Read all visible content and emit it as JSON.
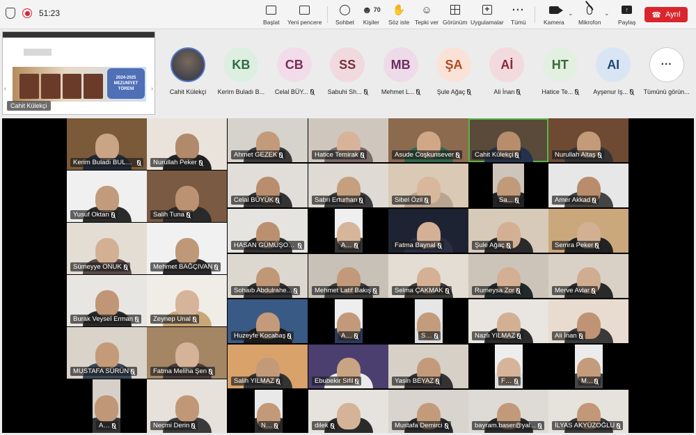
{
  "toolbar": {
    "timer": "51:23",
    "participant_count": "70",
    "buttons": {
      "start": "Başlat",
      "new_window": "Yeni pencere",
      "chat": "Sohbet",
      "people": "Kişiler",
      "raise_hand": "Söz iste",
      "react": "Tepki ver",
      "view": "Görünüm",
      "apps": "Uygulamalar",
      "more": "Tümü",
      "camera": "Kamera",
      "mic": "Mikrofon",
      "share": "Paylaş"
    },
    "leave_label": "Ayrıl",
    "leave_color": "#d9262d"
  },
  "share_thumb": {
    "presenter": "Cahit Külekçi",
    "banner_text_1": "2024-2025",
    "banner_text_2": "MEZUNİYET",
    "banner_text_3": "TÖRENİ"
  },
  "strip": {
    "items": [
      {
        "initials": "",
        "name": "Cahit Külekçi",
        "bg": "",
        "fg": "",
        "photo": true,
        "muted": false
      },
      {
        "initials": "KB",
        "name": "Kerim Buladı B...",
        "bg": "#dcefe1",
        "fg": "#2f6b45",
        "photo": false,
        "muted": false
      },
      {
        "initials": "CB",
        "name": "Celal BÜY...",
        "bg": "#f3dcea",
        "fg": "#7a2d5a",
        "photo": false,
        "muted": true
      },
      {
        "initials": "SS",
        "name": "Sabuhi Sh...",
        "bg": "#f1dadf",
        "fg": "#74303f",
        "photo": false,
        "muted": true
      },
      {
        "initials": "MB",
        "name": "Mehmet L...",
        "bg": "#eedbe9",
        "fg": "#6e2c60",
        "photo": false,
        "muted": true
      },
      {
        "initials": "ŞA",
        "name": "Şule Ağaç",
        "bg": "#fbe2d6",
        "fg": "#b24a1e",
        "photo": false,
        "muted": true
      },
      {
        "initials": "Aİ",
        "name": "Ali İnan",
        "bg": "#f3dade",
        "fg": "#8c2a3a",
        "photo": false,
        "muted": true
      },
      {
        "initials": "HT",
        "name": "Hatice Te...",
        "bg": "#e2efe1",
        "fg": "#3a6a3a",
        "photo": false,
        "muted": true
      },
      {
        "initials": "AI",
        "name": "Ayşenur Iş...",
        "bg": "#d9e5f4",
        "fg": "#24467a",
        "photo": false,
        "muted": true
      },
      {
        "initials": "···",
        "name": "Tümünü görün...",
        "bg": "#ffffff",
        "fg": "#333333",
        "photo": false,
        "muted": false
      }
    ]
  },
  "gallery": {
    "tiles": [
      {
        "name": "Kerim Buladı BULADI",
        "bg": "#7b5a3a",
        "skin": "#c9a585",
        "shirt": "#1f2a3a"
      },
      {
        "name": "Nurullah Peker",
        "bg": "#e9e3dc",
        "skin": "#b08a6a",
        "shirt": "#222"
      },
      {
        "name": "Ahmet GEZEK",
        "bg": "#d6d2cc",
        "skin": "#c39a7a",
        "shirt": "#3a3a3a"
      },
      {
        "name": "Hatice Temirak",
        "bg": "#cfc7bd",
        "skin": "#d7b39a",
        "shirt": "#7a6a6a"
      },
      {
        "name": "Asude Coşkunsever",
        "bg": "#8c6a4e",
        "skin": "#d0a887",
        "shirt": "#2f6a4a"
      },
      {
        "name": "Cahit Külekçi",
        "bg": "#5a4a3a",
        "skin": "#b88d6c",
        "shirt": "#24314d"
      },
      {
        "name": "Nurullah Altaş",
        "bg": "#6e4a33",
        "skin": "#c49b78",
        "shirt": "#333"
      },
      {
        "name": "Yusuf Oktan",
        "bg": "#f0f0f0",
        "skin": "#c29b7c",
        "shirt": "#2b2b2b"
      },
      {
        "name": "Salih Tuna",
        "bg": "#7a5a42",
        "skin": "#bb9272",
        "shirt": "#2a2a2a"
      },
      {
        "name": "Celal BÜYÜK",
        "bg": "#e1ddd8",
        "skin": "#b88e6e",
        "shirt": "#333"
      },
      {
        "name": "Sabri Erturhan",
        "bg": "#dfdad4",
        "skin": "#c4a07f",
        "shirt": "#3a3a3a"
      },
      {
        "name": "Sibel Özil",
        "bg": "#d9c9b5",
        "skin": "#d8b79c",
        "shirt": "#b9a58f"
      },
      {
        "name": "Sa...",
        "bg": "#cdc5bb",
        "skin": "#c19a7a",
        "shirt": "#222"
      },
      {
        "name": "Amer Akkad",
        "bg": "#e7e7e7",
        "skin": "#b98d6b",
        "shirt": "#444"
      },
      {
        "name": "Sümeyye ONUK",
        "bg": "#e3ddd4",
        "skin": "#d3b093",
        "shirt": "#5a4a4a"
      },
      {
        "name": "Mehmet BAĞÇIVAN",
        "bg": "#f1f1f1",
        "skin": "#bf9878",
        "shirt": "#2a2a2a"
      },
      {
        "name": "HASAN GÜMÜŞOĞLU",
        "bg": "#e6e4e0",
        "skin": "#bb9070",
        "shirt": "#333"
      },
      {
        "name": "Ay...",
        "bg": "#efefef",
        "skin": "#d6b59a",
        "shirt": "#333"
      },
      {
        "name": "Fatma Baynal",
        "bg": "#1e2333",
        "skin": "#d4b196",
        "shirt": "#2d2d44"
      },
      {
        "name": "Şule Ağaç",
        "bg": "#d7cab9",
        "skin": "#d3b094",
        "shirt": "#2a2a2a"
      },
      {
        "name": "Semra Peker",
        "bg": "#cba77c",
        "skin": "#d3b094",
        "shirt": "#222"
      },
      {
        "name": "Burak Veysel Erman",
        "bg": "#e8e6e3",
        "skin": "#c09676",
        "shirt": "#2a2a2a"
      },
      {
        "name": "Zeynep Unal",
        "bg": "#f0ece6",
        "skin": "#d6b499",
        "shirt": "#c9a777"
      },
      {
        "name": "Sohaıb Abdulrahe...",
        "bg": "#ddd8cf",
        "skin": "#c09777",
        "shirt": "#333"
      },
      {
        "name": "Mehmet Latif Bakış",
        "bg": "#c7c1b7",
        "skin": "#c29a79",
        "shirt": "#3c3c3c"
      },
      {
        "name": "Selma ÇAKMAK",
        "bg": "#e4ddd3",
        "skin": "#d4b195",
        "shirt": "#3e3a36"
      },
      {
        "name": "Rumeysa Zor",
        "bg": "#cdc4b9",
        "skin": "#d3af93",
        "shirt": "#1f2a2a"
      },
      {
        "name": "Merve Avlar",
        "bg": "#d9d1c6",
        "skin": "#d0ad91",
        "shirt": "#2a2a2a"
      },
      {
        "name": "MUSTAFA SÜRÜN",
        "bg": "#d9d3ca",
        "skin": "#c49a78",
        "shirt": "#3a4a5a"
      },
      {
        "name": "Fatma Meliha Şen",
        "bg": "#a48664",
        "skin": "#d5b398",
        "shirt": "#4a3a3a"
      },
      {
        "name": "Huzeyfe Kocabaş",
        "bg": "#3a5a86",
        "skin": "#c39b7a",
        "shirt": "#1a1a1a"
      },
      {
        "name": "Al...",
        "bg": "#eeeeee",
        "skin": "#c29a7a",
        "shirt": "#2a3a5a"
      },
      {
        "name": "Sa...",
        "bg": "#e6e6e6",
        "skin": "#c39c7c",
        "shirt": "#ddd"
      },
      {
        "name": "Nazlı YILMAZ",
        "bg": "#e9e6e1",
        "skin": "#d3b094",
        "shirt": "#2a2a2a"
      },
      {
        "name": "Ali İnan",
        "bg": "#e8dcd0",
        "skin": "#bf9373",
        "shirt": "#3a3a3a"
      },
      {
        "name": "Salih YILMAZ",
        "bg": "#d9a26a",
        "skin": "#c29a79",
        "shirt": "#333"
      },
      {
        "name": "Ebubekir Sifil",
        "bg": "#4a3f6e",
        "skin": "#c9a483",
        "shirt": "#eaeaea"
      },
      {
        "name": "Yasin BEYAZ",
        "bg": "#d7d0c6",
        "skin": "#c39b7b",
        "shirt": "#333"
      },
      {
        "name": "Fa...",
        "bg": "#ededed",
        "skin": "#d6b49a",
        "shirt": "#ddd"
      },
      {
        "name": "Mu...",
        "bg": "#ececec",
        "skin": "#c49c7c",
        "shirt": "#444"
      },
      {
        "name": "Ad...",
        "bg": "#d6d0c8",
        "skin": "#c09777",
        "shirt": "#333"
      },
      {
        "name": "Necmi Derin",
        "bg": "#e6e1da",
        "skin": "#c19877",
        "shirt": "#3a3a3a"
      },
      {
        "name": "Na...",
        "bg": "#e9e9e9",
        "skin": "#c29a7a",
        "shirt": "#2a2a2a"
      },
      {
        "name": "dilek",
        "bg": "#e6e3de",
        "skin": "#d5b398",
        "shirt": "#2a2a2a"
      },
      {
        "name": "Mustafa Demirci",
        "bg": "#d9d4ce",
        "skin": "#c39b7a",
        "shirt": "#2a2a2a"
      },
      {
        "name": "bayram.baser@yal...",
        "bg": "#dedbd7",
        "skin": "#c29a79",
        "shirt": "#2a2a2a"
      },
      {
        "name": "İLYAS AKYÜZOĞLU",
        "bg": "#e6e2dc",
        "skin": "#c29878",
        "shirt": "#3a3a3a"
      }
    ]
  }
}
